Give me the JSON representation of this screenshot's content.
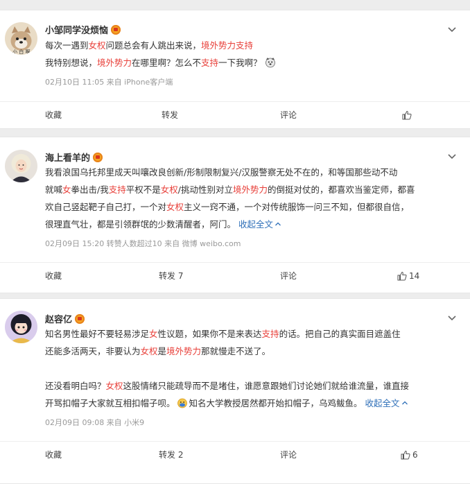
{
  "posts": [
    {
      "user": "小邹同学没烦恼",
      "lines": [
        [
          {
            "t": "每次一遇到"
          },
          {
            "t": "女权",
            "hl": true
          },
          {
            "t": "问题总会有人跳出来说，"
          },
          {
            "t": "境外势力支持",
            "hl": true
          }
        ],
        [
          {
            "t": "我特别想说，"
          },
          {
            "t": "境外势力",
            "hl": true
          },
          {
            "t": "在哪里啊？怎么不"
          },
          {
            "t": "支持",
            "hl": true
          },
          {
            "t": "一下我啊？"
          }
        ]
      ],
      "meta": "02月10日 11:05  来自 iPhone客户端",
      "actions": {
        "fav": "收藏",
        "repost": "转发",
        "comment": "评论",
        "like": ""
      }
    },
    {
      "user": "海上看羊的",
      "lines": [
        [
          {
            "t": "我看浪国乌托邦里成天叫嚷改良创新/形制限制复兴/汉服警察无处不在的，和等国那些动不动"
          }
        ],
        [
          {
            "t": "就喊"
          },
          {
            "t": "女",
            "hl": true
          },
          {
            "t": "拳出击/我"
          },
          {
            "t": "支持",
            "hl": true
          },
          {
            "t": "平权不是"
          },
          {
            "t": "女权",
            "hl": true
          },
          {
            "t": "/挑动性别对立"
          },
          {
            "t": "境外势力",
            "hl": true
          },
          {
            "t": "的倒挺对仗的，都喜欢当鉴定师，都喜"
          }
        ],
        [
          {
            "t": "欢自己竖起靶子自己打，一个对"
          },
          {
            "t": "女权",
            "hl": true
          },
          {
            "t": "主义一窍不通，一个对传统服饰一问三不知，但都很自信，"
          }
        ],
        [
          {
            "t": "很理直气壮，都是引领群氓的少数清醒者，阿门。 "
          },
          {
            "t": "收起全文",
            "blue": true
          }
        ]
      ],
      "meta": "02月09日 15:20 转赞人数超过10  来自 微博 weibo.com",
      "actions": {
        "fav": "收藏",
        "repost": "转发 7",
        "comment": "评论",
        "like": "14"
      }
    },
    {
      "user": "赵容亿",
      "lines": [
        [
          {
            "t": "知名男性最好不要轻易涉足"
          },
          {
            "t": "女",
            "hl": true
          },
          {
            "t": "性议题，如果你不是来表达"
          },
          {
            "t": "支持",
            "hl": true
          },
          {
            "t": "的话。把自己的真实面目遮盖住"
          }
        ],
        [
          {
            "t": "还能多活两天，非要认为"
          },
          {
            "t": "女权",
            "hl": true
          },
          {
            "t": "是"
          },
          {
            "t": "境外势力",
            "hl": true
          },
          {
            "t": "那就慢走不送了。"
          }
        ],
        [],
        [
          {
            "t": "还没看明白吗？"
          },
          {
            "t": "女权",
            "hl": true
          },
          {
            "t": "这股情绪只能疏导而不是堵住，谁愿意跟她们讨论她们就给谁流量，谁直接"
          }
        ],
        [
          {
            "t": "开骂扣帽子大家就互相扣帽子呗。"
          },
          {
            "t": "知名大学教授居然都开始扣帽子，乌鸡鲅鱼。 "
          },
          {
            "t": "收起全文",
            "blue": true
          }
        ]
      ],
      "meta": "02月09日 09:08  来自 小米9",
      "actions": {
        "fav": "收藏",
        "repost": "转发 2",
        "comment": "评论",
        "like": "6"
      }
    }
  ],
  "icons": {
    "verified": "vip-badge-icon",
    "more": "chevron-down-icon",
    "like": "thumbs-up-icon",
    "collapse": "chevron-up-icon"
  },
  "colors": {
    "highlight": "#e8403a",
    "link": "#2e6fb8",
    "meta": "#999999",
    "bg": "#ededed"
  }
}
